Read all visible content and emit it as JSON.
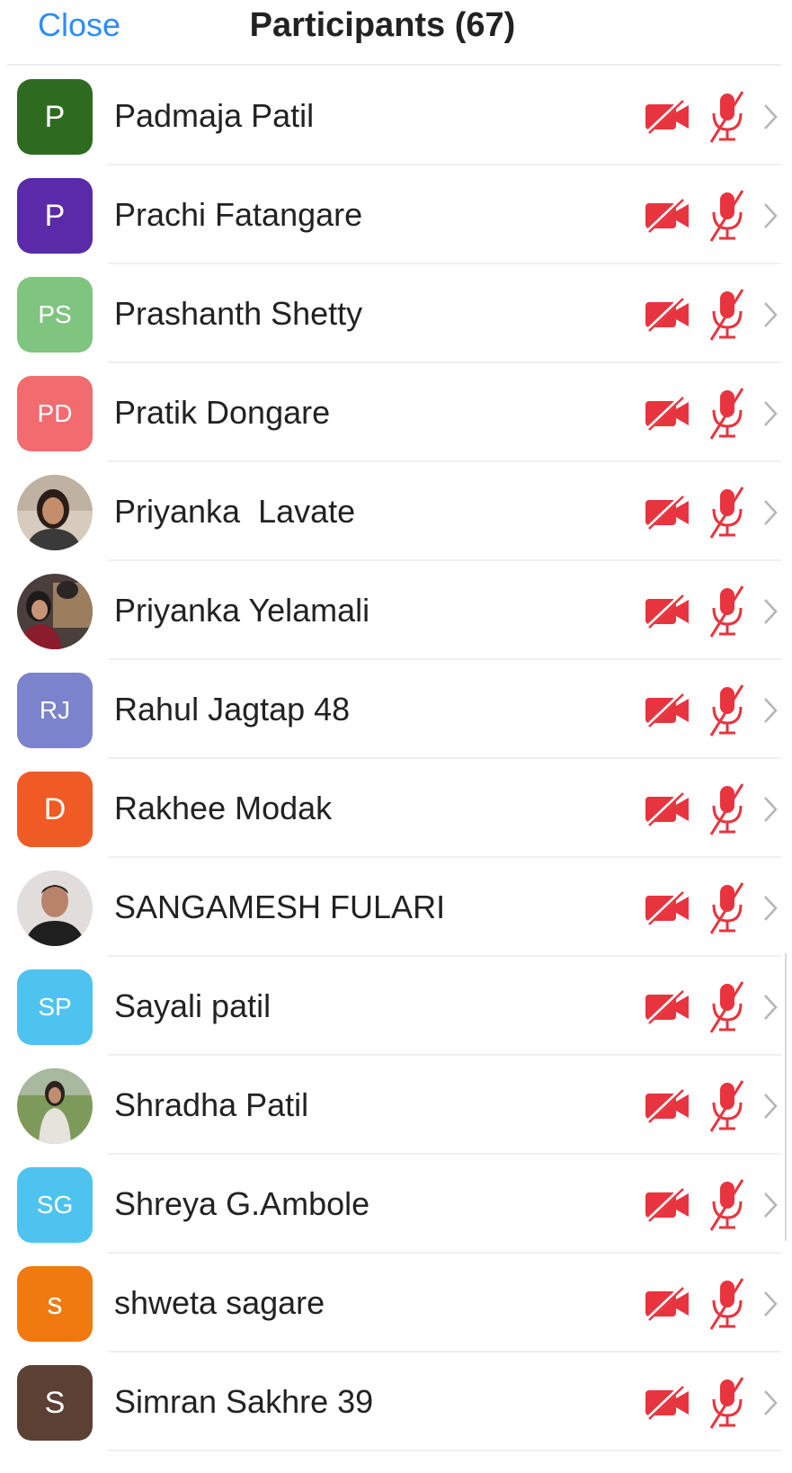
{
  "header": {
    "close_label": "Close",
    "title": "Participants (67)"
  },
  "colors": {
    "accent": "#2d8cff",
    "muted_red": "#e8343e",
    "chevron": "#b5b5b5"
  },
  "participants": [
    {
      "name": "Padmaja Patil",
      "initials": "P",
      "color": "#2e6b21",
      "photo": null,
      "video": "off",
      "audio": "muted"
    },
    {
      "name": "Prachi Fatangare",
      "initials": "P",
      "color": "#5a2aa8",
      "photo": null,
      "video": "off",
      "audio": "muted"
    },
    {
      "name": "Prashanth Shetty",
      "initials": "PS",
      "color": "#7fc47f",
      "photo": null,
      "video": "off",
      "audio": "muted"
    },
    {
      "name": "Pratik Dongare",
      "initials": "PD",
      "color": "#f26b6e",
      "photo": null,
      "video": "off",
      "audio": "muted"
    },
    {
      "name": "Priyanka  Lavate",
      "initials": "",
      "color": "#c9b8a6",
      "photo": "woman-portrait",
      "video": "off",
      "audio": "muted"
    },
    {
      "name": "Priyanka Yelamali",
      "initials": "",
      "color": "#5b4d49",
      "photo": "two-women-selfie",
      "video": "off",
      "audio": "muted"
    },
    {
      "name": "Rahul Jagtap 48",
      "initials": "RJ",
      "color": "#7b83cc",
      "photo": null,
      "video": "off",
      "audio": "muted"
    },
    {
      "name": "Rakhee Modak",
      "initials": "D",
      "color": "#f05a24",
      "photo": null,
      "video": "off",
      "audio": "muted"
    },
    {
      "name": "SANGAMESH FULARI",
      "initials": "",
      "color": "#d9d4d0",
      "photo": "man-portrait",
      "video": "off",
      "audio": "muted"
    },
    {
      "name": "Sayali patil",
      "initials": "SP",
      "color": "#4fc3f0",
      "photo": null,
      "video": "off",
      "audio": "muted"
    },
    {
      "name": "Shradha Patil",
      "initials": "",
      "color": "#6e8a4f",
      "photo": "woman-outdoor",
      "video": "off",
      "audio": "muted"
    },
    {
      "name": "Shreya G.Ambole",
      "initials": "SG",
      "color": "#4fc3f0",
      "photo": null,
      "video": "off",
      "audio": "muted"
    },
    {
      "name": "shweta sagare",
      "initials": "s",
      "color": "#f07a10",
      "photo": null,
      "video": "off",
      "audio": "muted"
    },
    {
      "name": "Simran Sakhre 39",
      "initials": "S",
      "color": "#5c4033",
      "photo": null,
      "video": "off",
      "audio": "muted"
    }
  ],
  "icons": {
    "camera": "video-off-icon",
    "mic": "mic-muted-icon",
    "chevron": "chevron-right-icon"
  }
}
